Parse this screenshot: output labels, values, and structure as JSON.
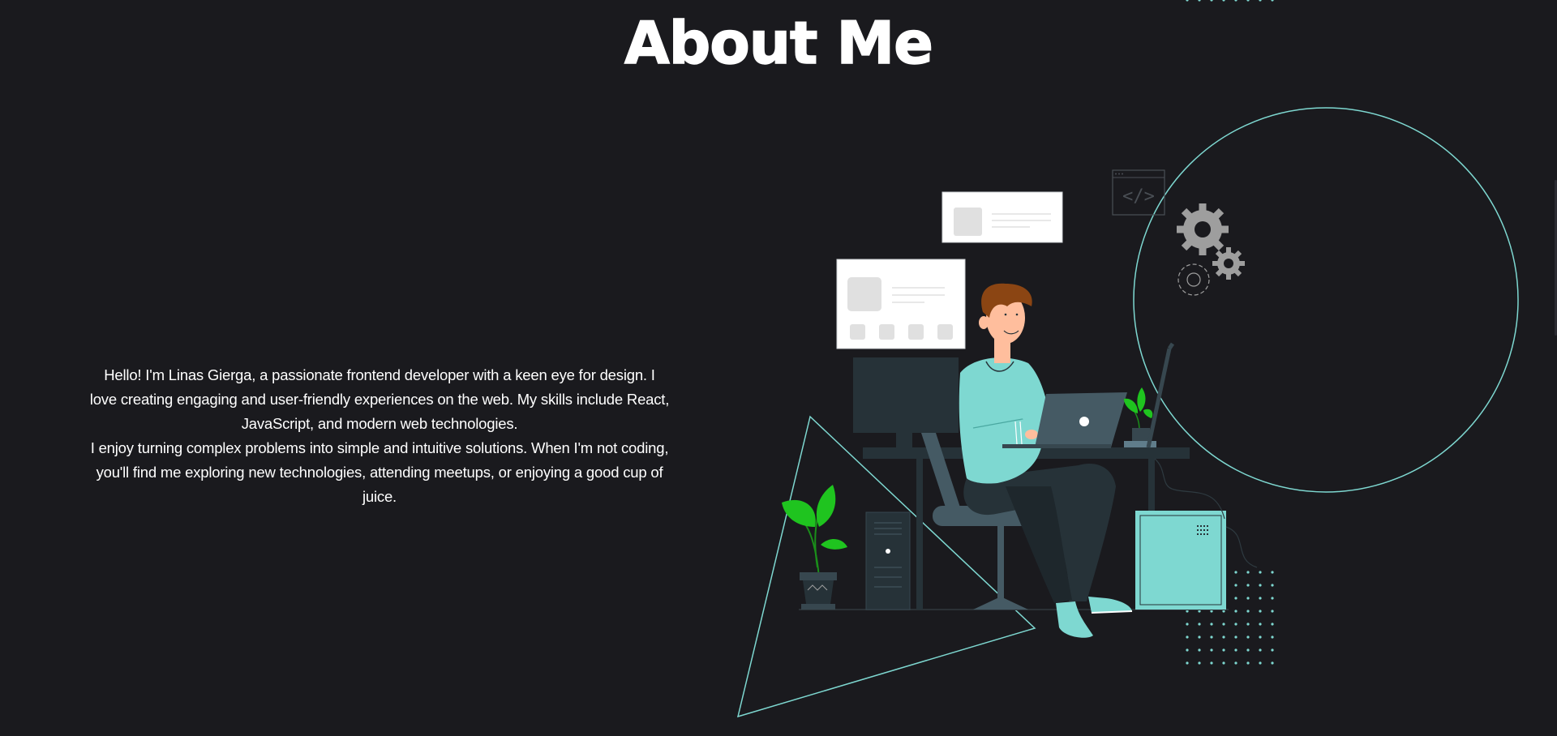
{
  "section": {
    "title": "About Me"
  },
  "bio": {
    "paragraph1": "Hello! I'm Linas Gierga, a passionate frontend developer with a keen eye for design. I love creating engaging and user-friendly experiences on the web. My skills include React, JavaScript, and modern web technologies.",
    "paragraph2": "I enjoy turning complex problems into simple and intuitive solutions. When I'm not coding, you'll find me exploring new technologies, attending meetups, or enjoying a good cup of juice."
  },
  "illustration": {
    "icon": "developer-at-desk-illustration",
    "code_window_text": "</>"
  },
  "colors": {
    "background": "#1a1a1e",
    "accent": "#7ed8d1",
    "leaf": "#1fc41f",
    "dark_furniture": "#263238"
  }
}
